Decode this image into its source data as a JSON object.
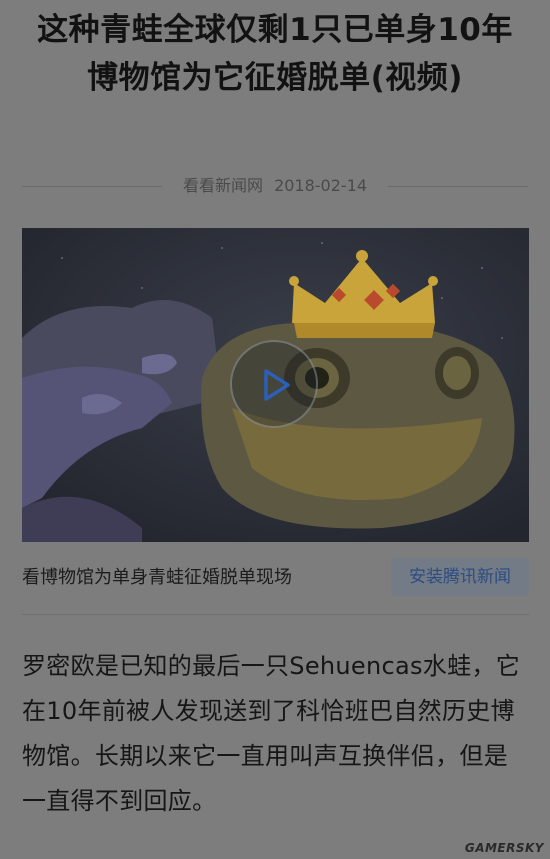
{
  "article": {
    "title": "这种青蛙全球仅剩1只已单身10年 博物馆为它征婚脱单(视频)",
    "source": "看看新闻网",
    "date": "2018-02-14"
  },
  "video": {
    "play_icon": "play-icon",
    "caption": "看博物馆为单身青蛙征婚脱单现场",
    "install_label": "安装腾讯新闻"
  },
  "body": {
    "paragraph": "罗密欧是已知的最后一只Sehuencas水蛙，它在10年前被人发现送到了科恰班巴自然历史博物馆。长期以来它一直用叫声互换伴侣，但是一直得不到回应。"
  },
  "watermark": "GAMERSKY",
  "colors": {
    "overlay_gray": "#7d7d7d",
    "crown_gold": "#c9a43a",
    "play_blue": "#2b5fb8"
  }
}
